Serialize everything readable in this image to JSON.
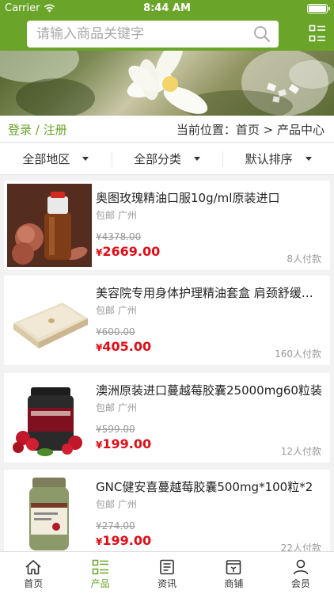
{
  "status": {
    "carrier": "Carrier",
    "time": "8:44 AM"
  },
  "search": {
    "placeholder": "请输入商品关键字"
  },
  "auth": {
    "login": "登录",
    "sep": " / ",
    "register": "注册"
  },
  "breadcrumb": "当前位置：首页 > 产品中心",
  "filters": [
    {
      "label": "全部地区"
    },
    {
      "label": "全部分类"
    },
    {
      "label": "默认排序"
    }
  ],
  "products": [
    {
      "title": "奥图玫瑰精油口服10g/ml原装进口",
      "shipping": "包邮 广州",
      "old_price": "¥4378.00",
      "currency": "¥",
      "price": "2669.00",
      "sold": "8人付款"
    },
    {
      "title": "美容院专用身体护理精油套盒 肩颈舒缓精油",
      "shipping": "包邮 广州",
      "old_price": "¥600.00",
      "currency": "¥",
      "price": "405.00",
      "sold": "160人付款"
    },
    {
      "title": "澳洲原装进口蔓越莓胶囊25000mg60粒装",
      "shipping": "包邮 广州",
      "old_price": "¥599.00",
      "currency": "¥",
      "price": "199.00",
      "sold": "12人付款"
    },
    {
      "title": "GNC健安喜蔓越莓胶囊500mg*100粒*2",
      "shipping": "包邮 广州",
      "old_price": "¥274.00",
      "currency": "¥",
      "price": "199.00",
      "sold": "22人付款"
    }
  ],
  "product_images": [
    {
      "label": ""
    },
    {
      "label": ""
    },
    {
      "label": ""
    },
    {
      "label": ""
    }
  ],
  "tabs": [
    {
      "label": "首页",
      "icon": "home-icon"
    },
    {
      "label": "产品",
      "icon": "list-icon",
      "active": true
    },
    {
      "label": "资讯",
      "icon": "news-icon"
    },
    {
      "label": "商铺",
      "icon": "store-icon"
    },
    {
      "label": "会员",
      "icon": "user-icon"
    }
  ],
  "colors": {
    "brand": "#6aa52a",
    "price": "#e00d16"
  }
}
